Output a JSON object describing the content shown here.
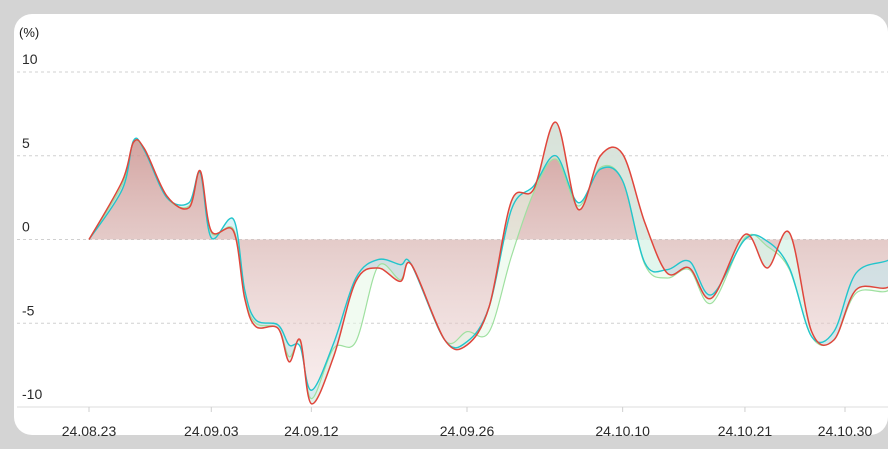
{
  "chart_data": {
    "type": "line",
    "unit_label": "(%)",
    "ylim": [
      -10,
      10
    ],
    "y_ticks": [
      10,
      5,
      0,
      -5,
      -10
    ],
    "y_tick_labels": [
      "10",
      "5",
      "0",
      "-5",
      "-10"
    ],
    "x_range": [
      "2024-08-23",
      "2024-11-04"
    ],
    "x_ticks": [
      "2024-08-23",
      "2024-09-03",
      "2024-09-12",
      "2024-09-26",
      "2024-10-10",
      "2024-10-21",
      "2024-10-30"
    ],
    "x_tick_labels": [
      "24.08.23",
      "24.09.03",
      "24.09.12",
      "24.09.26",
      "24.10.10",
      "24.10.21",
      "24.10.30"
    ],
    "grid": "horizontal dashed",
    "legend": "none",
    "colors": {
      "red": "#e0463c",
      "cyan": "#22c5cc",
      "green": "#9fe0a0",
      "fill_pos": "#e8a8a0",
      "fill_neg": "#bfeaf0",
      "grid": "#d0d0d0"
    },
    "series": [
      {
        "color": "red",
        "values": [
          [
            "2024-08-23",
            0.0
          ],
          [
            "2024-08-26",
            3.5
          ],
          [
            "2024-08-27",
            5.8
          ],
          [
            "2024-08-28",
            5.4
          ],
          [
            "2024-08-30",
            2.6
          ],
          [
            "2024-09-01",
            1.9
          ],
          [
            "2024-09-02",
            4.1
          ],
          [
            "2024-09-03",
            0.5
          ],
          [
            "2024-09-05",
            0.5
          ],
          [
            "2024-09-06",
            -3.5
          ],
          [
            "2024-09-07",
            -5.2
          ],
          [
            "2024-09-09",
            -5.3
          ],
          [
            "2024-09-10",
            -7.3
          ],
          [
            "2024-09-11",
            -6.0
          ],
          [
            "2024-09-12",
            -9.8
          ],
          [
            "2024-09-14",
            -7.0
          ],
          [
            "2024-09-16",
            -2.5
          ],
          [
            "2024-09-18",
            -1.7
          ],
          [
            "2024-09-20",
            -2.5
          ],
          [
            "2024-09-21",
            -1.5
          ],
          [
            "2024-09-24",
            -6.0
          ],
          [
            "2024-09-26",
            -6.3
          ],
          [
            "2024-09-28",
            -4.0
          ],
          [
            "2024-09-30",
            2.3
          ],
          [
            "2024-10-02",
            3.0
          ],
          [
            "2024-10-04",
            7.0
          ],
          [
            "2024-10-06",
            1.8
          ],
          [
            "2024-10-08",
            5.0
          ],
          [
            "2024-10-10",
            5.1
          ],
          [
            "2024-10-12",
            1.0
          ],
          [
            "2024-10-14",
            -2.0
          ],
          [
            "2024-10-16",
            -1.7
          ],
          [
            "2024-10-18",
            -3.5
          ],
          [
            "2024-10-21",
            0.3
          ],
          [
            "2024-10-23",
            -1.7
          ],
          [
            "2024-10-25",
            0.4
          ],
          [
            "2024-10-27",
            -5.5
          ],
          [
            "2024-10-29",
            -6.0
          ],
          [
            "2024-10-31",
            -3.0
          ],
          [
            "2024-11-03",
            -2.8
          ],
          [
            "2024-11-04",
            -0.8
          ]
        ]
      },
      {
        "color": "cyan",
        "values": [
          [
            "2024-08-23",
            0.0
          ],
          [
            "2024-08-26",
            3.0
          ],
          [
            "2024-08-27",
            5.9
          ],
          [
            "2024-08-28",
            5.3
          ],
          [
            "2024-08-30",
            2.5
          ],
          [
            "2024-09-01",
            2.2
          ],
          [
            "2024-09-02",
            4.0
          ],
          [
            "2024-09-03",
            0.1
          ],
          [
            "2024-09-05",
            1.2
          ],
          [
            "2024-09-06",
            -3.0
          ],
          [
            "2024-09-07",
            -4.8
          ],
          [
            "2024-09-09",
            -5.1
          ],
          [
            "2024-09-10",
            -6.3
          ],
          [
            "2024-09-11",
            -6.4
          ],
          [
            "2024-09-12",
            -9.0
          ],
          [
            "2024-09-14",
            -6.2
          ],
          [
            "2024-09-16",
            -2.3
          ],
          [
            "2024-09-18",
            -1.2
          ],
          [
            "2024-09-20",
            -1.5
          ],
          [
            "2024-09-21",
            -1.5
          ],
          [
            "2024-09-24",
            -6.0
          ],
          [
            "2024-09-26",
            -6.1
          ],
          [
            "2024-09-28",
            -4.0
          ],
          [
            "2024-09-30",
            1.8
          ],
          [
            "2024-10-02",
            3.2
          ],
          [
            "2024-10-04",
            5.0
          ],
          [
            "2024-10-06",
            2.2
          ],
          [
            "2024-10-08",
            4.2
          ],
          [
            "2024-10-10",
            3.5
          ],
          [
            "2024-10-12",
            -1.4
          ],
          [
            "2024-10-14",
            -1.8
          ],
          [
            "2024-10-16",
            -1.3
          ],
          [
            "2024-10-18",
            -3.3
          ],
          [
            "2024-10-21",
            0.0
          ],
          [
            "2024-10-23",
            -0.1
          ],
          [
            "2024-10-25",
            -1.7
          ],
          [
            "2024-10-27",
            -5.8
          ],
          [
            "2024-10-29",
            -5.5
          ],
          [
            "2024-10-31",
            -2.0
          ],
          [
            "2024-11-03",
            -1.2
          ],
          [
            "2024-11-04",
            -0.2
          ]
        ]
      },
      {
        "color": "green",
        "values": [
          [
            "2024-08-23",
            0.0
          ],
          [
            "2024-08-26",
            3.3
          ],
          [
            "2024-08-27",
            5.8
          ],
          [
            "2024-08-28",
            5.3
          ],
          [
            "2024-08-30",
            2.5
          ],
          [
            "2024-09-01",
            2.0
          ],
          [
            "2024-09-02",
            4.0
          ],
          [
            "2024-09-03",
            0.4
          ],
          [
            "2024-09-05",
            0.6
          ],
          [
            "2024-09-06",
            -3.4
          ],
          [
            "2024-09-07",
            -5.0
          ],
          [
            "2024-09-09",
            -5.3
          ],
          [
            "2024-09-10",
            -7.0
          ],
          [
            "2024-09-11",
            -6.1
          ],
          [
            "2024-09-12",
            -9.5
          ],
          [
            "2024-09-14",
            -6.5
          ],
          [
            "2024-09-16",
            -6.1
          ],
          [
            "2024-09-18",
            -1.6
          ],
          [
            "2024-09-20",
            -2.4
          ],
          [
            "2024-09-21",
            -1.5
          ],
          [
            "2024-09-24",
            -6.0
          ],
          [
            "2024-09-26",
            -5.5
          ],
          [
            "2024-09-28",
            -5.5
          ],
          [
            "2024-09-30",
            -1.0
          ],
          [
            "2024-10-02",
            2.8
          ],
          [
            "2024-10-04",
            4.8
          ],
          [
            "2024-10-06",
            2.0
          ],
          [
            "2024-10-08",
            4.3
          ],
          [
            "2024-10-10",
            3.5
          ],
          [
            "2024-10-12",
            -1.5
          ],
          [
            "2024-10-14",
            -2.3
          ],
          [
            "2024-10-16",
            -1.8
          ],
          [
            "2024-10-18",
            -3.8
          ],
          [
            "2024-10-21",
            0.1
          ],
          [
            "2024-10-23",
            -0.4
          ],
          [
            "2024-10-25",
            -1.8
          ],
          [
            "2024-10-27",
            -5.8
          ],
          [
            "2024-10-29",
            -6.0
          ],
          [
            "2024-10-31",
            -3.2
          ],
          [
            "2024-11-03",
            -3.0
          ],
          [
            "2024-11-04",
            -0.9
          ]
        ]
      }
    ]
  }
}
